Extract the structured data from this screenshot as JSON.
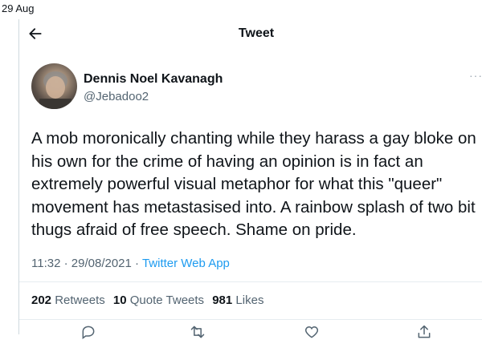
{
  "top_bar": {
    "date": "29 Aug"
  },
  "header": {
    "title": "Tweet"
  },
  "author": {
    "name": "Dennis Noel Kavanagh",
    "handle": "@Jebadoo2"
  },
  "tweet": {
    "text": "A mob moronically chanting while they harass a gay bloke on his own for the crime of having an opinion is in fact an extremely powerful visual metaphor for what this \"queer\" movement has metastasised into. A rainbow splash of two bit thugs afraid of free speech. Shame on pride.",
    "time": "11:32",
    "date": "29/08/2021",
    "separator": "·",
    "app": "Twitter Web App"
  },
  "stats": {
    "retweets_count": "202",
    "retweets_label": "Retweets",
    "quotes_count": "10",
    "quotes_label": "Quote Tweets",
    "likes_count": "981",
    "likes_label": "Likes"
  },
  "more_label": "···",
  "icons": {
    "back": "arrow-left-icon",
    "reply": "reply-icon",
    "retweet": "retweet-icon",
    "like": "heart-icon",
    "share": "share-icon"
  },
  "colors": {
    "link": "#1d9bf0",
    "secondary": "#536471",
    "text": "#0f1419"
  }
}
